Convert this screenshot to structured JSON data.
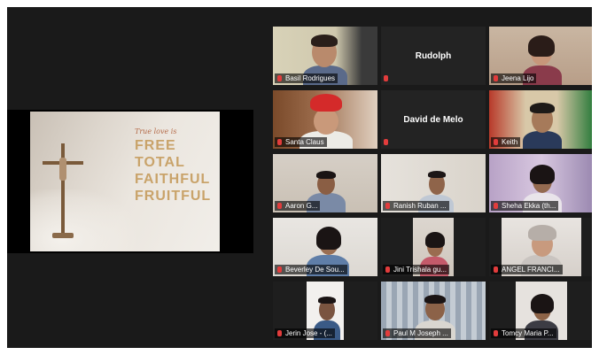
{
  "slide": {
    "small_text": "True love is",
    "line1": "FREE",
    "line2": "TOTAL",
    "line3": "FAITHFUL",
    "line4": "FRUITFUL"
  },
  "participants": [
    {
      "name": "Basil Rodrigues",
      "video": true
    },
    {
      "name": "Rudolph",
      "video": false
    },
    {
      "name": "Jeena Lijo",
      "video": true
    },
    {
      "name": "Santa Claus",
      "video": true
    },
    {
      "name": "David de Melo",
      "video": false
    },
    {
      "name": "Keith",
      "video": true
    },
    {
      "name": "Aaron G...",
      "video": true
    },
    {
      "name": "Ranish Ruban ...",
      "video": true
    },
    {
      "name": "Sheha Ekka (th...",
      "video": true
    },
    {
      "name": "Beverley De Sou...",
      "video": true
    },
    {
      "name": "Jini Trishala gu...",
      "video": true
    },
    {
      "name": "ANGEL FRANCI...",
      "video": true
    },
    {
      "name": "Jerin Jose - (...",
      "video": true
    },
    {
      "name": "Paul M Joseph ...",
      "video": true
    },
    {
      "name": "Tomcy Maria P...",
      "video": true
    }
  ],
  "colors": {
    "window_bg": "#1a1a1a",
    "active_speaker_outline": "#c9d44a",
    "muted_mic": "#e23c3c"
  },
  "icons": {
    "mic_muted": "mic-muted-icon"
  }
}
